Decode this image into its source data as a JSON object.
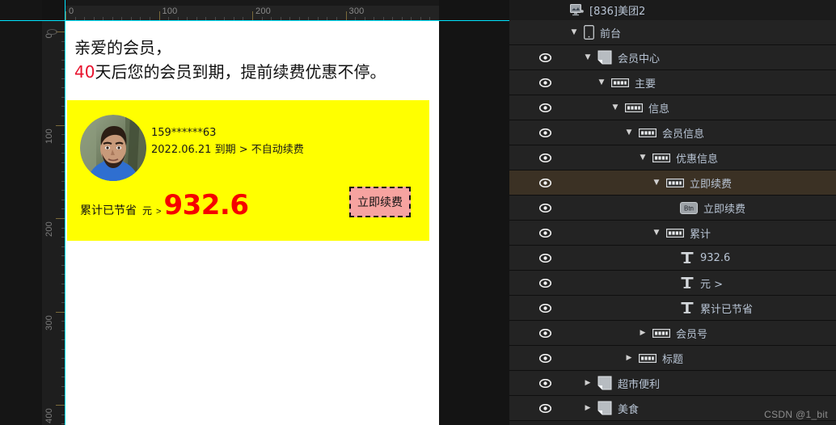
{
  "rulers": {
    "horizontal_labels": [
      "0",
      "100",
      "200",
      "300"
    ],
    "vertical_labels": [
      "0",
      "100",
      "200",
      "300"
    ]
  },
  "canvas": {
    "headline_line1": "亲爱的会员，",
    "headline_days": "40",
    "headline_line2_rest": "天后您的会员到期，提前续费优惠不停。",
    "card": {
      "account": "159******63",
      "expiry": "2022.06.21 到期 > 不自动续费",
      "saved_label": "累计已节省",
      "saved_unit": "元",
      "saved_arrow": ">",
      "saved_amount": "932.6",
      "renew_button": "立即续费",
      "bg_color": "#ffff00",
      "amount_color": "#f50000",
      "button_bg": "#f6a3a0"
    }
  },
  "layers_panel": {
    "watermark": "CSDN @1_bit",
    "selected_index": 7,
    "rows": [
      {
        "label": "[836]美团2",
        "icon": "screen-icon",
        "indent": 1,
        "arrow": "none",
        "eye": false,
        "title": true
      },
      {
        "label": "前台",
        "icon": "phone-icon",
        "indent": 2,
        "arrow": "down",
        "eye": false,
        "title": false
      },
      {
        "label": "会员中心",
        "icon": "page-icon",
        "indent": 3,
        "arrow": "down",
        "eye": true,
        "title": false
      },
      {
        "label": "主要",
        "icon": "group-icon",
        "indent": 4,
        "arrow": "down",
        "eye": true,
        "title": false
      },
      {
        "label": "信息",
        "icon": "group-icon",
        "indent": 5,
        "arrow": "down",
        "eye": true,
        "title": false
      },
      {
        "label": "会员信息",
        "icon": "group-icon",
        "indent": 6,
        "arrow": "down",
        "eye": true,
        "title": false
      },
      {
        "label": "优惠信息",
        "icon": "group-icon",
        "indent": 7,
        "arrow": "down",
        "eye": true,
        "title": false
      },
      {
        "label": "立即续费",
        "icon": "group-icon",
        "indent": 8,
        "arrow": "down",
        "eye": true,
        "title": false
      },
      {
        "label": "立即续费",
        "icon": "btn-icon",
        "indent": 9,
        "arrow": "none",
        "eye": true,
        "title": false
      },
      {
        "label": "累计",
        "icon": "group-icon",
        "indent": 8,
        "arrow": "down",
        "eye": true,
        "title": false
      },
      {
        "label": "932.6",
        "icon": "text-icon",
        "indent": 9,
        "arrow": "none",
        "eye": true,
        "title": false
      },
      {
        "label": "元 >",
        "icon": "text-icon",
        "indent": 9,
        "arrow": "none",
        "eye": true,
        "title": false
      },
      {
        "label": "累计已节省",
        "icon": "text-icon",
        "indent": 9,
        "arrow": "none",
        "eye": true,
        "title": false
      },
      {
        "label": "会员号",
        "icon": "group-icon",
        "indent": 7,
        "arrow": "right",
        "eye": true,
        "title": false
      },
      {
        "label": "标题",
        "icon": "group-icon",
        "indent": 6,
        "arrow": "right",
        "eye": true,
        "title": false
      },
      {
        "label": "超市便利",
        "icon": "page-icon",
        "indent": 3,
        "arrow": "right",
        "eye": true,
        "title": false
      },
      {
        "label": "美食",
        "icon": "page-icon",
        "indent": 3,
        "arrow": "right",
        "eye": true,
        "title": false
      }
    ]
  }
}
